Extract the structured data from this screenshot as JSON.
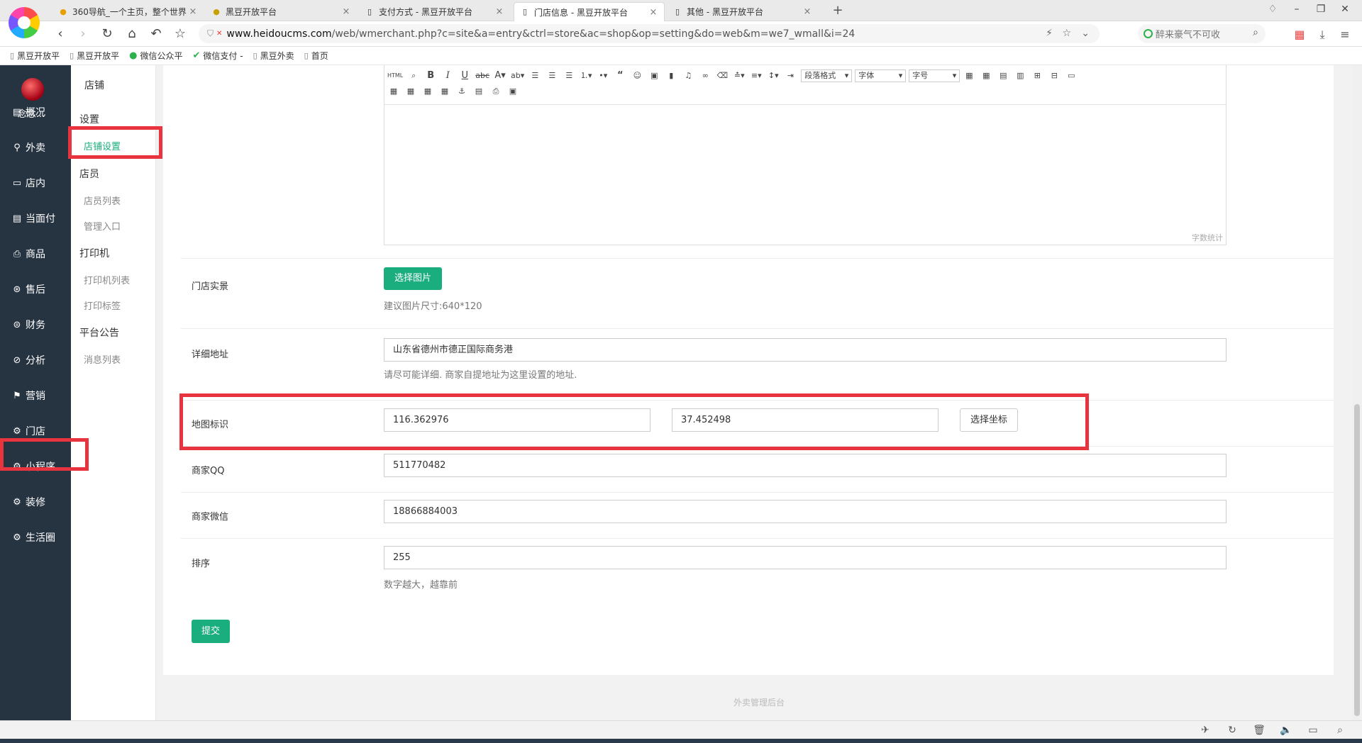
{
  "browser": {
    "tabs": [
      {
        "title": "360导航_一个主页，整个世界",
        "icon": "360-icon"
      },
      {
        "title": "黑豆开放平台",
        "icon": "heidou-icon"
      },
      {
        "title": "支付方式 - 黑豆开放平台",
        "icon": "doc-icon"
      },
      {
        "title": "门店信息 - 黑豆开放平台",
        "icon": "doc-icon",
        "active": true
      },
      {
        "title": "其他 - 黑豆开放平台",
        "icon": "doc-icon"
      }
    ],
    "url_host": "www.heidoucms.com",
    "url_path": "/web/wmerchant.php?c=site&a=entry&ctrl=store&ac=shop&op=setting&do=web&m=we7_wmall&i=24",
    "search_placeholder": "醉来豪气不可收",
    "bookmarks": [
      "黑豆开放平",
      "黑豆开放平",
      "微信公众平",
      "微信支付 -",
      "黑豆外卖",
      "首页"
    ]
  },
  "user": {
    "name": "念念..."
  },
  "main_nav": [
    {
      "label": "概况",
      "icon": "dashboard-icon"
    },
    {
      "label": "外卖",
      "icon": "delivery-icon"
    },
    {
      "label": "店内",
      "icon": "store-icon"
    },
    {
      "label": "当面付",
      "icon": "pay-icon"
    },
    {
      "label": "商品",
      "icon": "goods-icon"
    },
    {
      "label": "售后",
      "icon": "aftersale-icon"
    },
    {
      "label": "财务",
      "icon": "finance-icon"
    },
    {
      "label": "分析",
      "icon": "analytics-icon"
    },
    {
      "label": "营销",
      "icon": "marketing-icon"
    },
    {
      "label": "门店",
      "icon": "gear-icon",
      "active": true
    },
    {
      "label": "小程序",
      "icon": "gear-icon"
    },
    {
      "label": "装修",
      "icon": "gear-icon"
    },
    {
      "label": "生活圈",
      "icon": "gear-icon"
    }
  ],
  "sub_nav": {
    "title": "店铺",
    "groups": [
      {
        "label": "设置",
        "links": [
          "店铺设置"
        ]
      },
      {
        "label": "店员",
        "links": [
          "店员列表",
          "管理入口"
        ]
      },
      {
        "label": "打印机",
        "links": [
          "打印机列表",
          "打印标签"
        ]
      },
      {
        "label": "平台公告",
        "links": [
          "消息列表"
        ]
      }
    ],
    "active_link": "店铺设置"
  },
  "editor": {
    "font_format_select": "段落格式",
    "font_family_select": "字体",
    "font_size_select": "字号",
    "word_count_label": "字数统计"
  },
  "form": {
    "store_photo": {
      "label": "门店实景",
      "button": "选择图片",
      "help": "建议图片尺寸:640*120"
    },
    "address": {
      "label": "详细地址",
      "value": "山东省德州市德正国际商务港",
      "help": "请尽可能详细. 商家自提地址为这里设置的地址."
    },
    "map": {
      "label": "地图标识",
      "lng": "116.362976",
      "lat": "37.452498",
      "button": "选择坐标"
    },
    "qq": {
      "label": "商家QQ",
      "value": "511770482"
    },
    "wechat": {
      "label": "商家微信",
      "value": "18866884003"
    },
    "sort": {
      "label": "排序",
      "value": "255",
      "help": "数字越大，越靠前"
    },
    "submit": "提交"
  },
  "footer": "外卖管理后台",
  "colors": {
    "sidebar": "#263341",
    "accent": "#1aad7e",
    "highlight": "#e8343f"
  }
}
